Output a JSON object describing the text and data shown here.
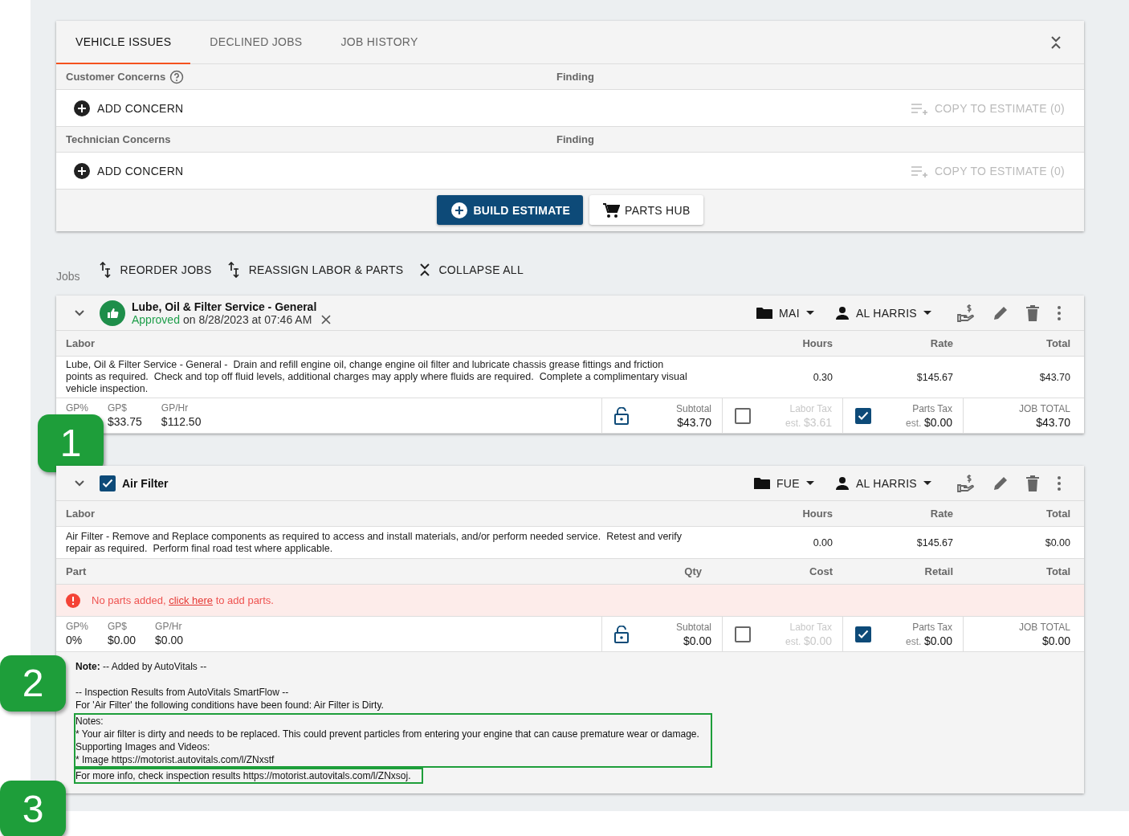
{
  "tabs": [
    {
      "label": "VEHICLE ISSUES",
      "selected": true
    },
    {
      "label": "DECLINED JOBS",
      "selected": false
    },
    {
      "label": "JOB HISTORY",
      "selected": false
    }
  ],
  "concern_sections": [
    {
      "title": "Customer Concerns",
      "help": true,
      "finding_label": "Finding",
      "add_label": "ADD CONCERN",
      "copy_label": "COPY TO ESTIMATE (0)",
      "copy_disabled": true
    },
    {
      "title": "Technician Concerns",
      "help": false,
      "finding_label": "Finding",
      "add_label": "ADD CONCERN",
      "copy_label": "COPY TO ESTIMATE (0)",
      "copy_disabled": true
    }
  ],
  "actions": {
    "build_estimate": "BUILD ESTIMATE",
    "parts_hub": "PARTS HUB"
  },
  "jobs_toolbar": {
    "label": "Jobs",
    "buttons": [
      {
        "kind": "reorder",
        "label": "REORDER JOBS"
      },
      {
        "kind": "reassign",
        "label": "REASSIGN LABOR & PARTS"
      },
      {
        "kind": "collapse",
        "label": "COLLAPSE ALL"
      }
    ]
  },
  "jobs": [
    {
      "title": "Lube, Oil & Filter Service - General",
      "approved": true,
      "approved_label": "Approved",
      "approved_date": "on 8/28/2023 at 07:46 AM",
      "category": "MAI",
      "technician": "AL HARRIS",
      "callout": "1",
      "labor_columns": [
        "Labor",
        "Hours",
        "Rate",
        "Total"
      ],
      "labor": {
        "description": "Lube, Oil & Filter Service - General -  Drain and refill engine oil, change engine oil filter and lubricate chassis grease fittings and friction points as required.  Check and top off fluid levels, additional charges may apply where fluids are required.  Complete a complimentary visual vehicle inspection.",
        "hours": "0.30",
        "rate": "$145.67",
        "total": "$43.70"
      },
      "gp": [
        {
          "label": "GP%"
        },
        {
          "label": "GP$",
          "value": "$33.75"
        },
        {
          "label": "GP/Hr",
          "value": "$112.50"
        }
      ],
      "subtotal": {
        "label": "Subtotal",
        "value": "$43.70"
      },
      "labor_tax": {
        "label": "Labor Tax",
        "est": "est.",
        "value": "$3.61",
        "checked": false
      },
      "parts_tax": {
        "label": "Parts Tax",
        "est": "est.",
        "value": "$0.00",
        "checked": true
      },
      "job_total": {
        "label": "JOB TOTAL",
        "value": "$43.70"
      }
    },
    {
      "title": "Air Filter",
      "approved": false,
      "checked": true,
      "category": "FUE",
      "technician": "AL HARRIS",
      "labor_columns": [
        "Labor",
        "Hours",
        "Rate",
        "Total"
      ],
      "labor": {
        "description": "Air Filter - Remove and Replace components as required to access and install materials, and/or perform needed service.  Retest and verify repair as required.  Perform final road test where applicable.",
        "hours": "0.00",
        "rate": "$145.67",
        "total": "$0.00"
      },
      "parts_columns": [
        "Part",
        "Qty",
        "Cost",
        "Retail",
        "Total"
      ],
      "parts_message": {
        "before": "No parts added,",
        "link": "click here",
        "after": "to add parts."
      },
      "gp": [
        {
          "label": "GP%",
          "value": "0%"
        },
        {
          "label": "GP$",
          "value": "$0.00"
        },
        {
          "label": "GP/Hr",
          "value": "$0.00"
        }
      ],
      "subtotal": {
        "label": "Subtotal",
        "value": "$0.00"
      },
      "labor_tax": {
        "label": "Labor Tax",
        "est": "est.",
        "value": "$0.00",
        "checked": false
      },
      "parts_tax": {
        "label": "Parts Tax",
        "est": "est.",
        "value": "$0.00",
        "checked": true
      },
      "job_total": {
        "label": "JOB TOTAL",
        "value": "$0.00"
      },
      "note": [
        {
          "highlighted": false,
          "lines": [
            "**Note:** -- Added by AutoVitals --"
          ]
        },
        {
          "highlighted": false,
          "callout": "2",
          "lines": [
            "-- Inspection Results from AutoVitals SmartFlow --",
            "For 'Air Filter' the following conditions have been found: Air Filter is Dirty."
          ]
        },
        {
          "highlighted": true,
          "lines": [
            "Notes:",
            "* Your air filter is dirty and needs to be replaced. This could prevent particles from entering your engine that can cause premature wear or damage.",
            "Supporting Images and Videos:",
            "* Image https://motorist.autovitals.com/l/ZNxstf"
          ]
        },
        {
          "highlighted": true,
          "callout": "3",
          "lines": [
            "For more info, check inspection results https://motorist.autovitals.com/l/ZNxsoj."
          ]
        }
      ]
    }
  ]
}
